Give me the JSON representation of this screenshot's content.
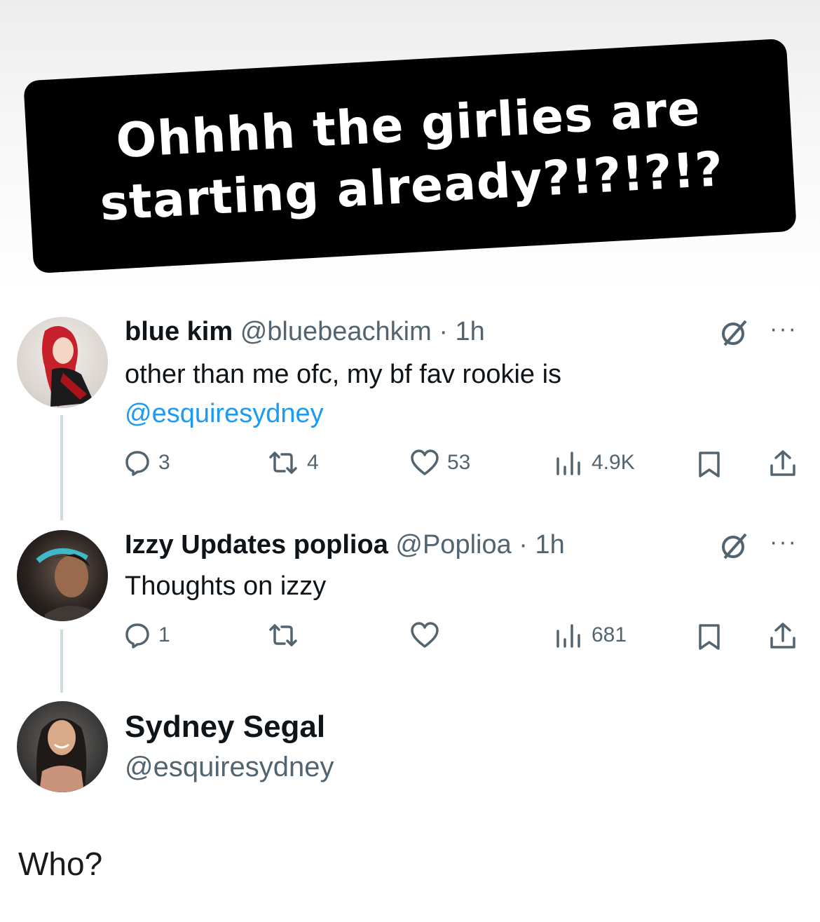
{
  "caption": {
    "line1": "Ohhhh the girlies are",
    "line2": "starting already?!?!?!?"
  },
  "tweets": [
    {
      "name": "blue kim",
      "meta": "@bluebeachkim · 1h",
      "text": "other than me ofc, my bf fav rookie is",
      "mention": "@esquiresydney",
      "replies": "3",
      "reposts": "4",
      "likes": "53",
      "views": "4.9K"
    },
    {
      "name": "Izzy Updates poplioa",
      "meta": "@Poplioa · 1h",
      "text": "Thoughts on izzy",
      "replies": "1",
      "reposts": "",
      "likes": "",
      "views": "681"
    }
  ],
  "profile": {
    "name": "Sydney Segal",
    "handle": "@esquiresydney"
  },
  "footer": {
    "text": "Who?"
  },
  "icons": {
    "reply": "reply-icon",
    "repost": "repost-icon",
    "like": "heart-icon",
    "views": "views-icon",
    "bookmark": "bookmark-icon",
    "share": "share-icon",
    "grok": "grok-icon",
    "more": "more-icon"
  },
  "colors": {
    "link": "#1d9bf0",
    "muted": "#536471",
    "caption_bg": "#000000"
  }
}
